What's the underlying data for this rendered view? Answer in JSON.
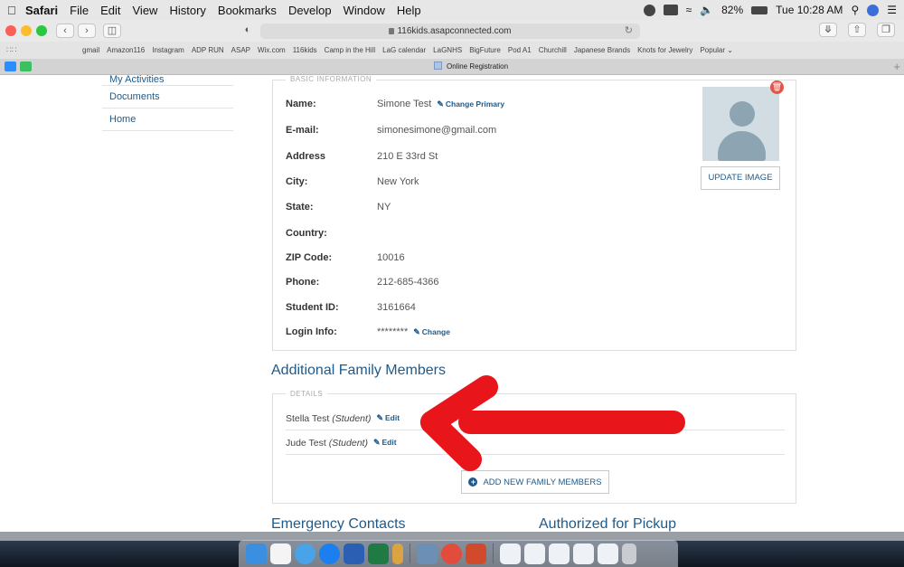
{
  "menubar": {
    "items": [
      "Safari",
      "File",
      "Edit",
      "View",
      "History",
      "Bookmarks",
      "Develop",
      "Window",
      "Help"
    ],
    "battery": "82%",
    "clock": "Tue 10:28 AM"
  },
  "toolbar": {
    "address": "116kids.asapconnected.com"
  },
  "favorites": [
    "gmail",
    "Amazon116",
    "Instagram",
    "ADP RUN",
    "ASAP",
    "Wix.com",
    "116kids",
    "Camp in the Hill",
    "LaG calendar",
    "LaGNHS",
    "BigFuture",
    "Pod A1",
    "Churchill",
    "Japanese Brands",
    "Knots for Jewelry",
    "Popular ⌄"
  ],
  "tab": {
    "title": "Online Registration"
  },
  "sidenav": {
    "items": [
      "My Activities",
      "Documents",
      "Home"
    ]
  },
  "basic_info": {
    "legend": "BASIC INFORMATION",
    "fields": [
      {
        "label": "Name:",
        "value": "Simone Test"
      },
      {
        "label": "E-mail:",
        "value": "simonesimone@gmail.com"
      },
      {
        "label": "Address",
        "value": "210 E 33rd St"
      },
      {
        "label": "City:",
        "value": "New York"
      },
      {
        "label": "State:",
        "value": "NY"
      },
      {
        "label": "Country:",
        "value": ""
      },
      {
        "label": "ZIP Code:",
        "value": "10016"
      },
      {
        "label": "Phone:",
        "value": "212-685-4366"
      },
      {
        "label": "Student ID:",
        "value": "3161664"
      },
      {
        "label": "Login Info:",
        "value": "********"
      }
    ],
    "change_primary": "Change Primary",
    "change": "Change",
    "update_image": "UPDATE IMAGE"
  },
  "family": {
    "heading": "Additional Family Members",
    "legend": "DETAILS",
    "members": [
      {
        "name": "Stella Test",
        "role": "(Student)"
      },
      {
        "name": "Jude Test",
        "role": "(Student)"
      }
    ],
    "edit_label": "Edit",
    "add_button": "ADD NEW FAMILY MEMBERS"
  },
  "emergency": {
    "heading": "Emergency Contacts"
  },
  "pickup": {
    "heading": "Authorized for Pickup"
  },
  "colors": {
    "link": "#1f5a8a",
    "annotation_arrow": "#e8151b"
  }
}
